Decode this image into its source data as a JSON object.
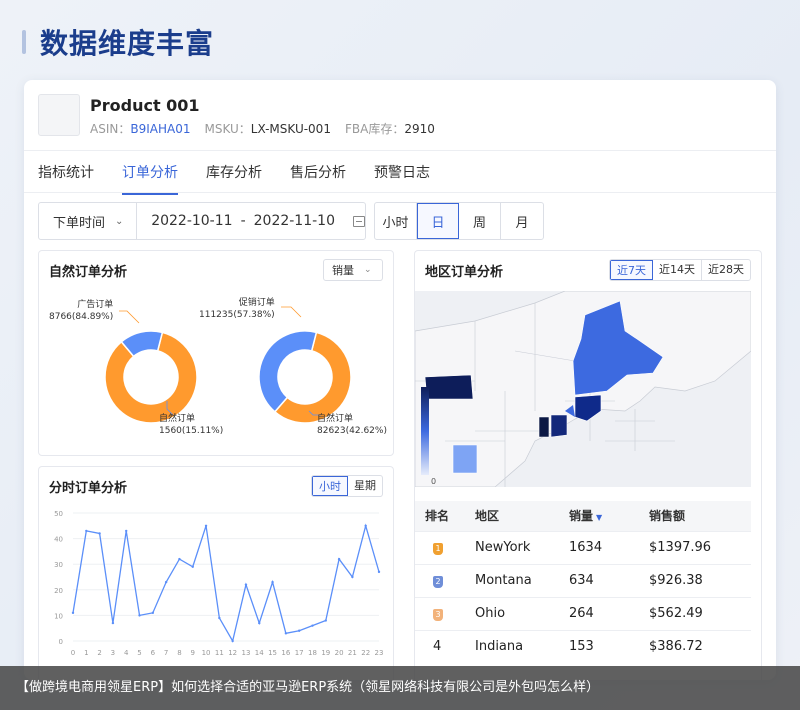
{
  "heading": "数据维度丰富",
  "product": {
    "name": "Product 001",
    "asin_label": "ASIN：",
    "asin": "B9IAHA01",
    "msku_label": "MSKU：",
    "msku": "LX-MSKU-001",
    "fba_label": "FBA库存：",
    "fba": "2910"
  },
  "tabs": [
    "指标统计",
    "订单分析",
    "库存分析",
    "售后分析",
    "预警日志"
  ],
  "filter": {
    "date_type": "下单时间",
    "date_start": "2022-10-11",
    "date_sep": "-",
    "date_end": "2022-11-10",
    "granularity": [
      "小时",
      "日",
      "周",
      "月"
    ]
  },
  "natural_orders": {
    "title": "自然订单分析",
    "select_value": "销量",
    "donut1": {
      "slices": [
        {
          "label": "广告订单",
          "value": 8766,
          "pct": "84.89%",
          "color": "#ff9a2e"
        },
        {
          "label": "自然订单",
          "value": 1560,
          "pct": "15.11%",
          "color": "#5b8ff9"
        }
      ],
      "label_top_1": "广告订单",
      "label_top_2": "8766(84.89%)",
      "label_bottom_1": "自然订单",
      "label_bottom_2": "1560(15.11%)"
    },
    "donut2": {
      "slices": [
        {
          "label": "促销订单",
          "value": 111235,
          "pct": "57.38%",
          "color": "#ff9a2e"
        },
        {
          "label": "自然订单",
          "value": 82623,
          "pct": "42.62%",
          "color": "#5b8ff9"
        }
      ],
      "label_top_1": "促销订单",
      "label_top_2": "111235(57.38%)",
      "label_bottom_1": "自然订单",
      "label_bottom_2": "82623(42.62%)"
    }
  },
  "hourly": {
    "title": "分时订单分析",
    "buttons": [
      "小时",
      "星期"
    ]
  },
  "chart_data": {
    "type": "line",
    "x": [
      0,
      1,
      2,
      3,
      4,
      5,
      6,
      7,
      8,
      9,
      10,
      11,
      12,
      13,
      14,
      15,
      16,
      17,
      18,
      19,
      20,
      21,
      22,
      23
    ],
    "series": [
      {
        "values": [
          11,
          43,
          42,
          7,
          43,
          10,
          11,
          23,
          32,
          29,
          45,
          9,
          0,
          22,
          7,
          23,
          3,
          4,
          6,
          8,
          32,
          25,
          45,
          27
        ]
      }
    ],
    "ylim": [
      0,
      50
    ],
    "yticks": [
      0,
      10,
      20,
      30,
      40,
      50
    ],
    "grid": true,
    "line_color": "#5b8ff9"
  },
  "region": {
    "title": "地区订单分析",
    "buttons": [
      "近7天",
      "近14天",
      "近28天"
    ],
    "legend_zero": "0",
    "table": {
      "headers": [
        "排名",
        "地区",
        "销量",
        "销售额"
      ],
      "rows": [
        {
          "rank": "1",
          "region": "NewYork",
          "qty": "1634",
          "amount": "$1397.96"
        },
        {
          "rank": "2",
          "region": "Montana",
          "qty": "634",
          "amount": "$926.38"
        },
        {
          "rank": "3",
          "region": "Ohio",
          "qty": "264",
          "amount": "$562.49"
        },
        {
          "rank": "4",
          "region": "Indiana",
          "qty": "153",
          "amount": "$386.72"
        }
      ]
    },
    "medal_colors": [
      "#f0a030",
      "#6f8ed8",
      "#f2b27a"
    ]
  },
  "footer": "【做跨境电商用领星ERP】如何选择合适的亚马逊ERP系统（领星网络科技有限公司是外包吗怎么样）"
}
